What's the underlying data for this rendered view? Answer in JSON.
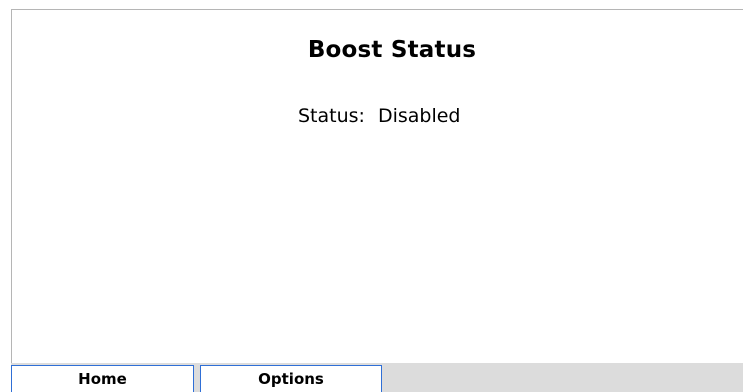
{
  "page": {
    "title": "Boost Status"
  },
  "status": {
    "label": "Status:",
    "value": "Disabled"
  },
  "tabs": [
    {
      "label": "Home"
    },
    {
      "label": "Options"
    }
  ],
  "colors": {
    "tab_border": "#2f6fd6",
    "tabbar_background": "#dcdcdc",
    "panel_border": "#b5b5b5"
  }
}
